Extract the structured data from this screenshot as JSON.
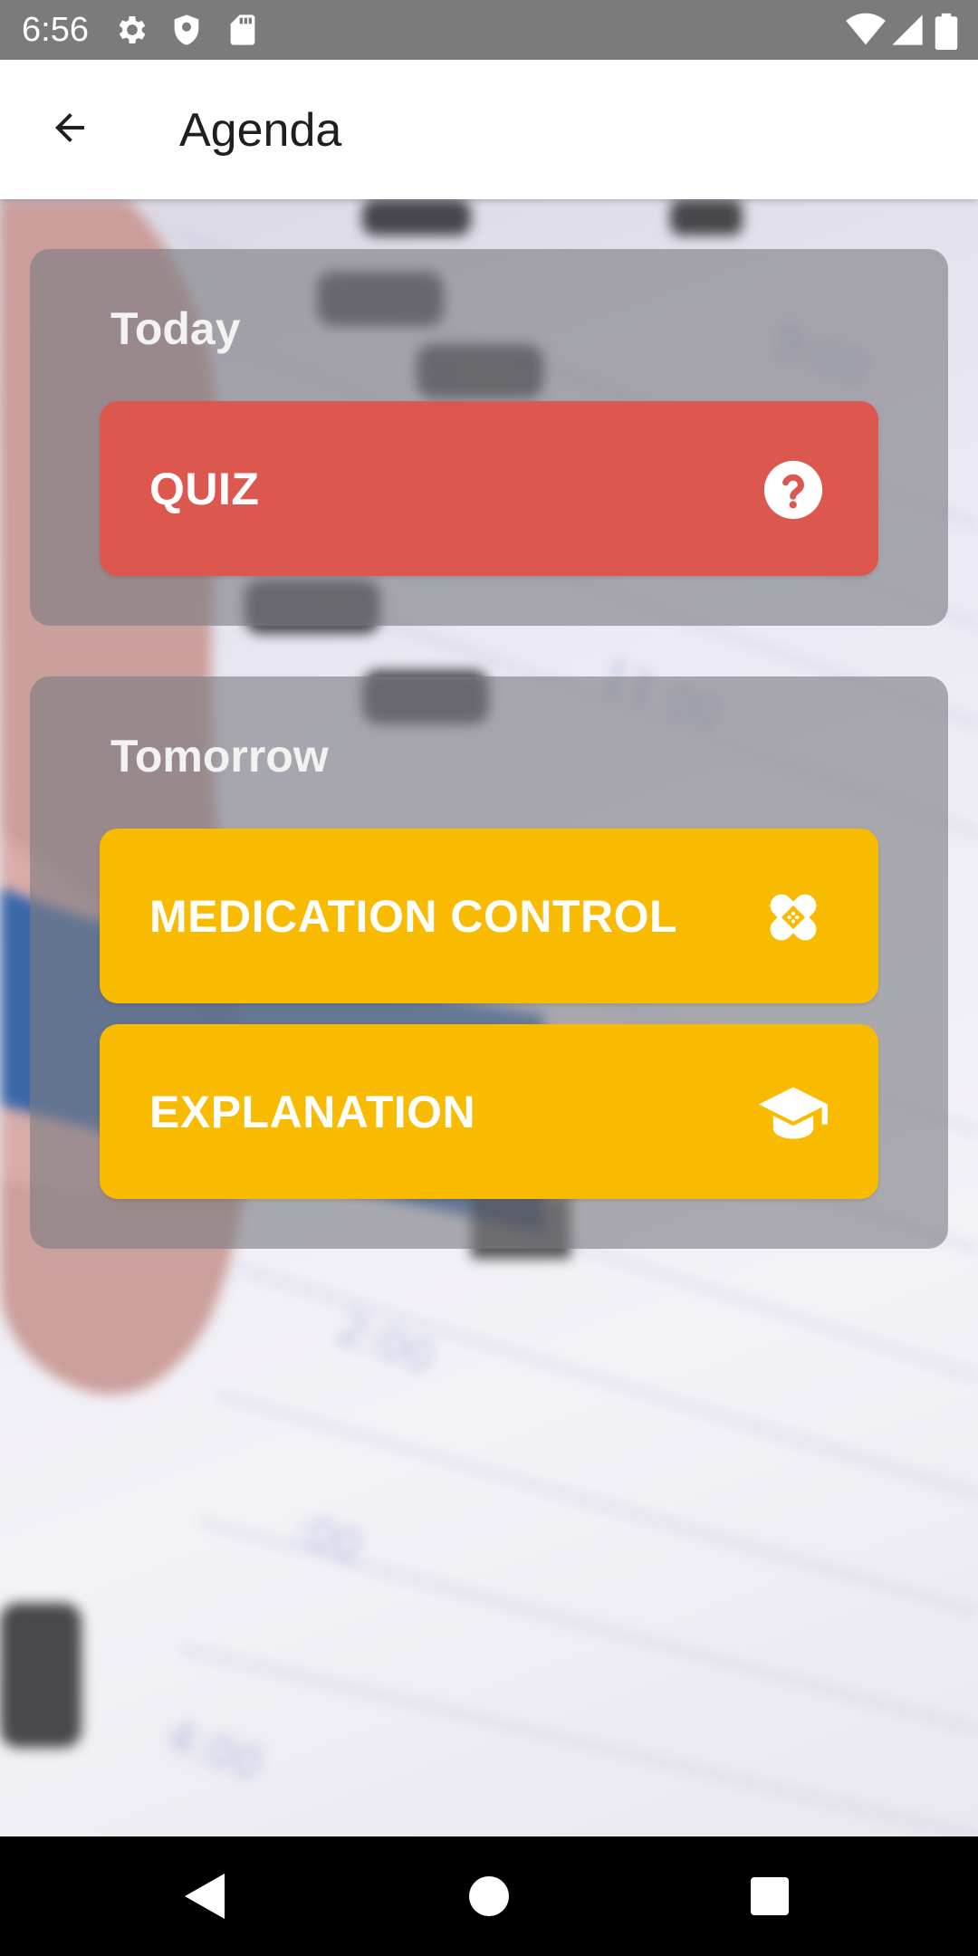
{
  "status_bar": {
    "time": "6:56",
    "icons": [
      "gear-icon",
      "shield-icon",
      "sd-card-icon",
      "wifi-icon",
      "cell-signal-icon",
      "battery-icon"
    ]
  },
  "app_bar": {
    "title": "Agenda",
    "back_icon": "arrow-back-icon"
  },
  "sections": [
    {
      "title": "Today",
      "items": [
        {
          "label": "QUIZ",
          "icon": "question-circle-icon",
          "color": "#dc574d"
        }
      ]
    },
    {
      "title": "Tomorrow",
      "items": [
        {
          "label": "MEDICATION CONTROL",
          "icon": "bandage-icon",
          "color": "#f8bb00"
        },
        {
          "label": "EXPLANATION",
          "icon": "graduation-cap-icon",
          "color": "#f8bb00"
        }
      ]
    }
  ],
  "nav_bar": {
    "icons": [
      "back-triangle-icon",
      "home-circle-icon",
      "recents-square-icon"
    ]
  },
  "colors": {
    "status_bar": "#7b7b7b",
    "app_bar": "#ffffff",
    "quiz": "#dc574d",
    "tomorrow_items": "#f8bb00",
    "section_overlay": "#7d7d82"
  }
}
